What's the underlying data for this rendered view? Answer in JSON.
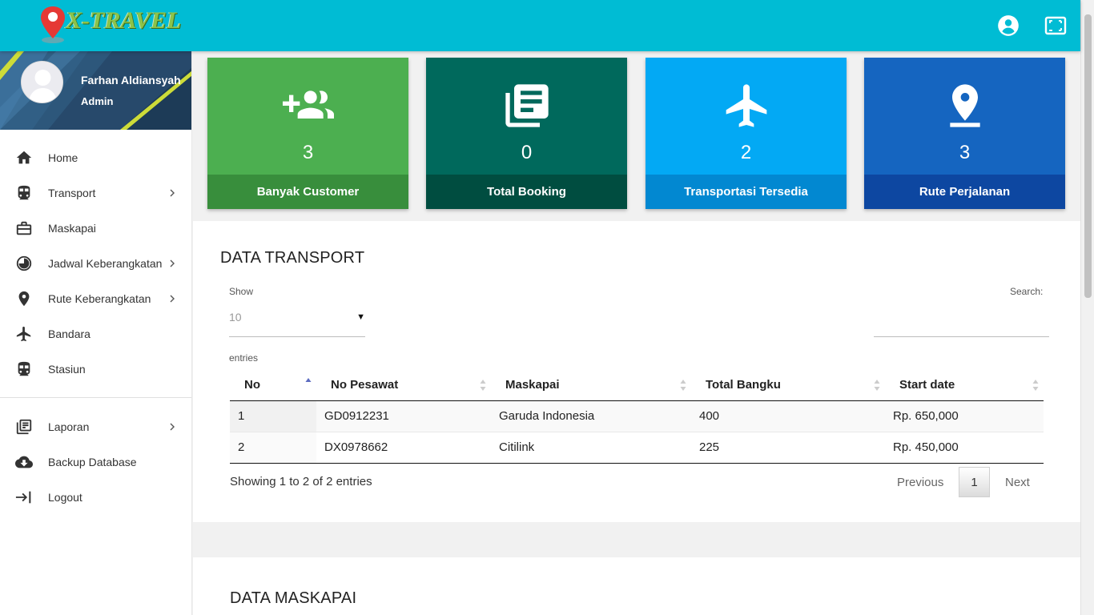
{
  "header": {
    "logo_text": "X-TRAVEL",
    "icons": [
      "account-circle-icon",
      "fullscreen-icon"
    ]
  },
  "user": {
    "name": "Farhan Aldiansyah",
    "role": "Admin"
  },
  "sidebar": {
    "items": [
      {
        "label": "Home",
        "icon": "home-icon",
        "chevron": false
      },
      {
        "label": "Transport",
        "icon": "train-icon",
        "chevron": true
      },
      {
        "label": "Maskapai",
        "icon": "briefcase-icon",
        "chevron": false
      },
      {
        "label": "Jadwal Keberangkatan",
        "icon": "clock-icon",
        "chevron": true
      },
      {
        "label": "Rute Keberangkatan",
        "icon": "location-pin-icon",
        "chevron": true
      },
      {
        "label": "Bandara",
        "icon": "airplane-icon",
        "chevron": false
      },
      {
        "label": "Stasiun",
        "icon": "subway-icon",
        "chevron": false
      }
    ],
    "items2": [
      {
        "label": "Laporan",
        "icon": "report-icon",
        "chevron": true
      },
      {
        "label": "Backup Database",
        "icon": "cloud-download-icon",
        "chevron": false
      },
      {
        "label": "Logout",
        "icon": "logout-icon",
        "chevron": false
      }
    ]
  },
  "info_boxes": [
    {
      "value": "3",
      "label": "Banyak Customer",
      "icon": "group-add-icon",
      "color": "#4caf50",
      "footer_color": "#388e3c"
    },
    {
      "value": "0",
      "label": "Total Booking",
      "icon": "library-books-icon",
      "color": "#00695c",
      "footer_color": "#004d40"
    },
    {
      "value": "2",
      "label": "Transportasi Tersedia",
      "icon": "airplane-icon",
      "color": "#03a9f4",
      "footer_color": "#0288d1"
    },
    {
      "value": "3",
      "label": "Rute Perjalanan",
      "icon": "pin-drop-icon",
      "color": "#1565c0",
      "footer_color": "#0d47a1"
    }
  ],
  "transport": {
    "title": "DATA TRANSPORT",
    "show_label": "Show",
    "page_length": "10",
    "entries_label": "entries",
    "search_label": "Search:",
    "columns": [
      "No",
      "No Pesawat",
      "Maskapai",
      "Total Bangku",
      "Start date"
    ],
    "rows": [
      [
        "1",
        "GD0912231",
        "Garuda Indonesia",
        "400",
        "Rp. 650,000"
      ],
      [
        "2",
        "DX0978662",
        "Citilink",
        "225",
        "Rp. 450,000"
      ]
    ],
    "info": "Showing 1 to 2 of 2 entries",
    "pagination": {
      "previous": "Previous",
      "current": "1",
      "next": "Next"
    }
  },
  "maskapai": {
    "title": "DATA MASKAPAI"
  },
  "colors": {
    "topbar": "#00bcd4",
    "sort_active": "#5c6bc0"
  }
}
